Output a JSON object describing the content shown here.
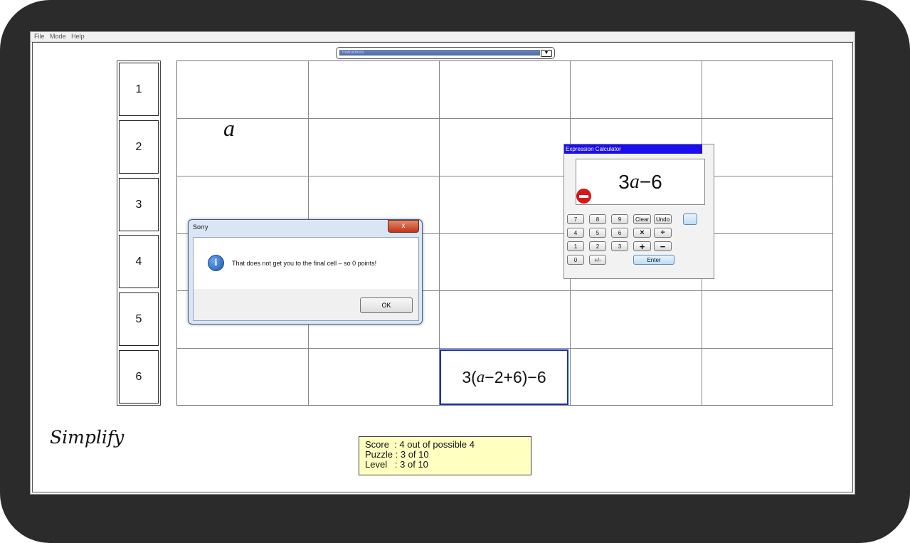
{
  "menu": [
    "File",
    "Mode",
    "Help"
  ],
  "dropdown": {
    "value": "Instructions"
  },
  "row_labels": [
    "1",
    "2",
    "3",
    "4",
    "5",
    "6"
  ],
  "grid": {
    "cell_start_text": "a",
    "target_prefix": "3(",
    "target_var": "a",
    "target_suffix": "−2+6)−6"
  },
  "task_label": "Simplify",
  "score": {
    "line1": "Score  : 4 out of possible 4",
    "line2": "Puzzle : 3 of 10",
    "line3": "Level   : 3 of 10"
  },
  "calculator": {
    "title": "Expression Calculator",
    "display_prefix": "3",
    "display_var": "a",
    "display_suffix": "−6",
    "buttons": [
      "7",
      "8",
      "9",
      "Clear",
      "Undo",
      "4",
      "5",
      "6",
      "×",
      "÷",
      "1",
      "2",
      "3",
      "+",
      "−",
      "0",
      "+/-",
      "Enter"
    ]
  },
  "dialog": {
    "title": "Sorry",
    "close": "x",
    "message": "That does not get you to the final cell – so 0 points!",
    "ok": "OK",
    "info_glyph": "i"
  }
}
